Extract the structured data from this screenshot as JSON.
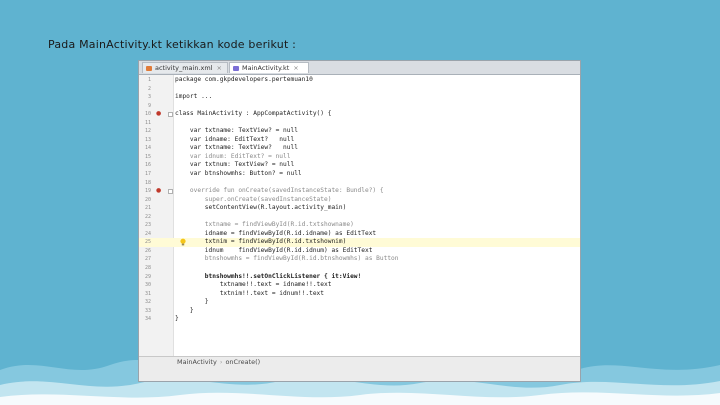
{
  "slide": {
    "instruction": "Pada MainActivity.kt ketikkan kode berikut :"
  },
  "ide": {
    "tabs": [
      {
        "label": "activity_main.xml",
        "icon": "xml-file-icon",
        "color": "#e07b39",
        "active": false
      },
      {
        "label": "MainActivity.kt",
        "icon": "kotlin-file-icon",
        "color": "#7b6fd6",
        "active": true
      }
    ],
    "lines": [
      {
        "n": "1",
        "text": "package com.gkpdevelopers.pertemuan10"
      },
      {
        "n": "2",
        "text": ""
      },
      {
        "n": "3",
        "text": "import ..."
      },
      {
        "n": "9",
        "text": ""
      },
      {
        "n": "10",
        "text": "class MainActivity : AppCompatActivity() {",
        "mark": true
      },
      {
        "n": "11",
        "text": ""
      },
      {
        "n": "12",
        "text": "    var txtname: TextView? = null"
      },
      {
        "n": "13",
        "text": "    var idname: EditText?   null"
      },
      {
        "n": "14",
        "text": "    var txtname: TextView?   null"
      },
      {
        "n": "15",
        "text": "    var idnum: EditText? = null",
        "faint": true
      },
      {
        "n": "16",
        "text": "    var txtnum: TextView? = null"
      },
      {
        "n": "17",
        "text": "    var btnshowmhs: Button? = null"
      },
      {
        "n": "18",
        "text": ""
      },
      {
        "n": "19",
        "text": "    override fun onCreate(savedInstanceState: Bundle?) {",
        "mark": true,
        "faint": true
      },
      {
        "n": "20",
        "text": "        super.onCreate(savedInstanceState)",
        "faint": true
      },
      {
        "n": "21",
        "text": "        setContentView(R.layout.activity_main)"
      },
      {
        "n": "22",
        "text": ""
      },
      {
        "n": "23",
        "text": "        txtname = findViewById(R.id.txtshowname)",
        "faint": true
      },
      {
        "n": "24",
        "text": "        idname = findViewById(R.id.idname) as EditText"
      },
      {
        "n": "25",
        "text": "        txtnim = findViewById(R.id.txtshownim)",
        "highlight": true,
        "bulb": true
      },
      {
        "n": "26",
        "text": "        idnum    findViewById(R.id.idnum) as EditText"
      },
      {
        "n": "27",
        "text": "        btnshowmhs = findViewById(R.id.btnshowmhs) as Button",
        "faint": true
      },
      {
        "n": "28",
        "text": ""
      },
      {
        "n": "29",
        "text": "        btnshowmhs!!.setOnClickListener { it:View!",
        "bold": true
      },
      {
        "n": "30",
        "text": "            txtname!!.text = idname!!.text"
      },
      {
        "n": "31",
        "text": "            txtnim!!.text = idnum!!.text"
      },
      {
        "n": "32",
        "text": "        }"
      },
      {
        "n": "33",
        "text": "    }"
      },
      {
        "n": "34",
        "text": "}"
      }
    ],
    "breadcrumb": {
      "class": "MainActivity",
      "method": "onCreate()"
    }
  },
  "colors": {
    "background": "#5fb3d0",
    "wave": "#ffffff",
    "line_highlight": "#fffbd6"
  }
}
